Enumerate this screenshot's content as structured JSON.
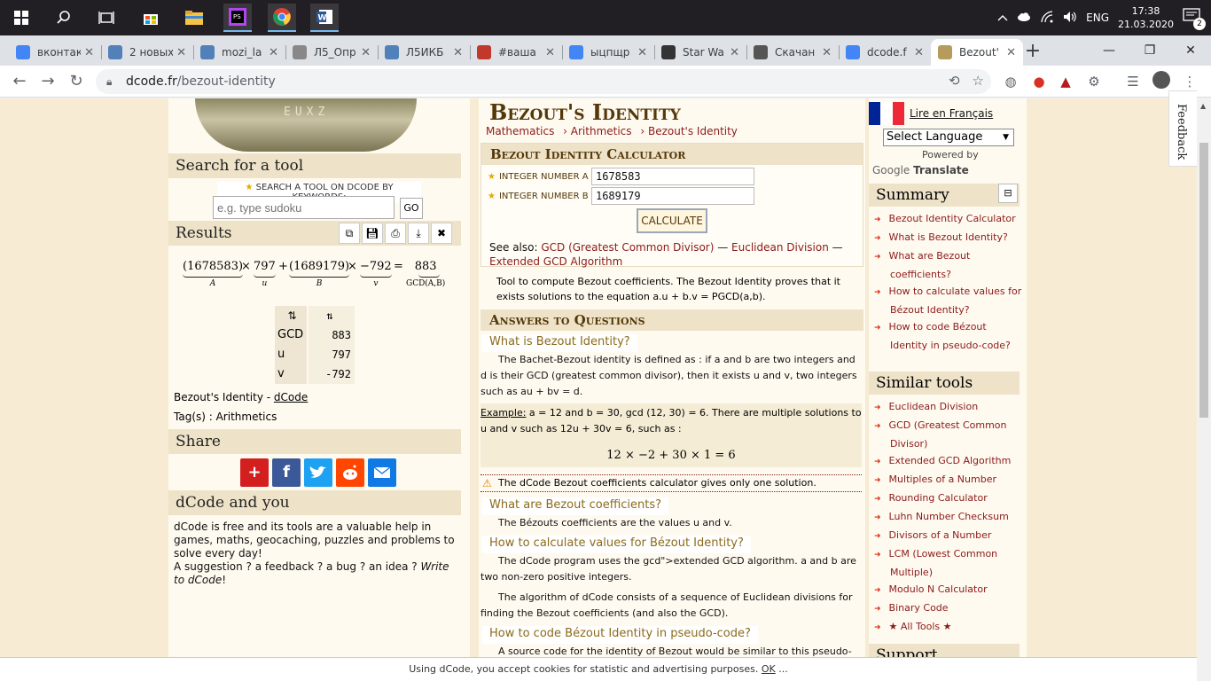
{
  "taskbar": {
    "lang": "ENG",
    "time": "17:38",
    "date": "21.03.2020",
    "notif_count": "2"
  },
  "tabs": [
    {
      "title": "вконтакте",
      "color": "#4285f4"
    },
    {
      "title": "2 новых",
      "color": "#5181b8"
    },
    {
      "title": "mozi_la",
      "color": "#5181b8"
    },
    {
      "title": "Л5_Опр",
      "color": "#888888"
    },
    {
      "title": "Л5ИКБ",
      "color": "#5181b8"
    },
    {
      "title": "#ваша",
      "color": "#c0392b"
    },
    {
      "title": "ыцпщр",
      "color": "#4285f4"
    },
    {
      "title": "Star Wa",
      "color": "#333333"
    },
    {
      "title": "Скачан",
      "color": "#555555"
    },
    {
      "title": "dcode.f",
      "color": "#4285f4"
    },
    {
      "title": "Bezout'",
      "color": "#b59b5c"
    }
  ],
  "address": {
    "host": "dcode.fr",
    "path": "/bezout-identity"
  },
  "left": {
    "logo_letters": "EUXZ",
    "search_heading": "Search for a tool",
    "search_label": "SEARCH A TOOL ON DCODE BY KEYWORDS:",
    "search_placeholder": "e.g. type sudoku",
    "go_label": "GO",
    "results_heading": "Results",
    "formula": {
      "a_val": "(1678583)",
      "a_sub": "A",
      "u_val": "797",
      "u_sub": "u",
      "b_val": "(1689179)",
      "b_sub": "B",
      "v_val": "−792",
      "v_sub": "v",
      "g_val": "883",
      "g_sub": "GCD(A,B)",
      "times": "×",
      "plus": "+",
      "eq": "="
    },
    "table_head": [
      "⇅",
      "⇅"
    ],
    "table_rows": [
      {
        "k": "GCD",
        "v": "883"
      },
      {
        "k": "u",
        "v": "797"
      },
      {
        "k": "v",
        "v": "-792"
      }
    ],
    "attribution_text": "Bezout's Identity - ",
    "attribution_link": "dCode",
    "tags": "Tag(s) : Arithmetics",
    "share_heading": "Share",
    "you_heading": "dCode and you",
    "you_text1": "dCode is free and its tools are a valuable help in games, maths, geocaching, puzzles and problems to solve every day!",
    "you_text2": "A suggestion ? a feedback ? a bug ? an idea ? ",
    "you_link": "Write to dCode",
    "you_end": "!"
  },
  "main": {
    "title": "Bezout's Identity",
    "breadcrumb": [
      "Mathematics",
      "› Arithmetics",
      "› Bezout's Identity"
    ],
    "calc_title": "Bezout Identity Calculator",
    "label_a": "INTEGER NUMBER A",
    "value_a": "1678583",
    "label_b": "INTEGER NUMBER B",
    "value_b": "1689179",
    "calc_button": "CALCULATE",
    "see_also": "See also: ",
    "see_gcd": "GCD (Greatest Common Divisor)",
    "see_div": "Euclidean Division",
    "see_ext": "Extended GCD Algorithm",
    "dash": " — ",
    "tool_desc": "Tool to compute Bezout coefficients. The Bezout Identity proves that it exists solutions to the equation a.u + b.v = PGCD(a,b).",
    "aq_heading": "Answers to Questions",
    "q1": "What is Bezout Identity?",
    "q1_text": "The Bachet-Bezout identity is defined as : if a and b are two integers and d is their GCD (greatest common divisor), then it exists u and v, two integers such as au + bv = d.",
    "example_label": "Example:",
    "example_text": " a = 12 and b = 30, gcd (12, 30) = 6. There are multiple solutions to u and v such as 12u + 30v = 6, such as :",
    "example_eq": "12 × −2 + 30 × 1 = 6",
    "warning": "The dCode Bezout coefficients calculator gives only one solution.",
    "q2": "What are Bezout coefficients?",
    "q2_text": "The Bézouts coefficients are the values u and v.",
    "q3": "How to calculate values for Bézout Identity?",
    "q3_text1": "The dCode program uses the gcd\">extended GCD algorithm. a and b are two non-zero positive integers.",
    "q3_text2": "The algorithm of dCode consists of a sequence of Euclidean divisions for finding the Bezout coefficients (and also the GCD).",
    "q4": "How to code Bézout Identity in pseudo-code?",
    "q4_text": "A source code for the identity of Bezout would be similar to this pseudo-"
  },
  "right": {
    "lire": "Lire en Français",
    "lang_select": "Select Language",
    "powered": "Powered by",
    "google": "Google",
    "translate": "Translate",
    "summary_heading": "Summary",
    "summary_items": [
      "Bezout Identity Calculator",
      "What is Bezout Identity?",
      "What are Bezout coefficients?",
      "How to calculate values for Bézout Identity?",
      "How to code Bézout Identity in pseudo-code?"
    ],
    "similar_heading": "Similar tools",
    "similar_items": [
      "Euclidean Division",
      "GCD (Greatest Common Divisor)",
      "Extended GCD Algorithm",
      "Multiples of a Number",
      "Rounding Calculator",
      "Luhn Number Checksum",
      "Divisors of a Number",
      "LCM (Lowest Common Multiple)",
      "Modulo N Calculator",
      "Binary Code",
      "★ All Tools ★"
    ],
    "support_heading": "Support"
  },
  "feedback": "Feedback",
  "cookie": {
    "text": "Using dCode, you accept cookies for statistic and advertising purposes. ",
    "ok": "OK",
    "more": " ..."
  }
}
